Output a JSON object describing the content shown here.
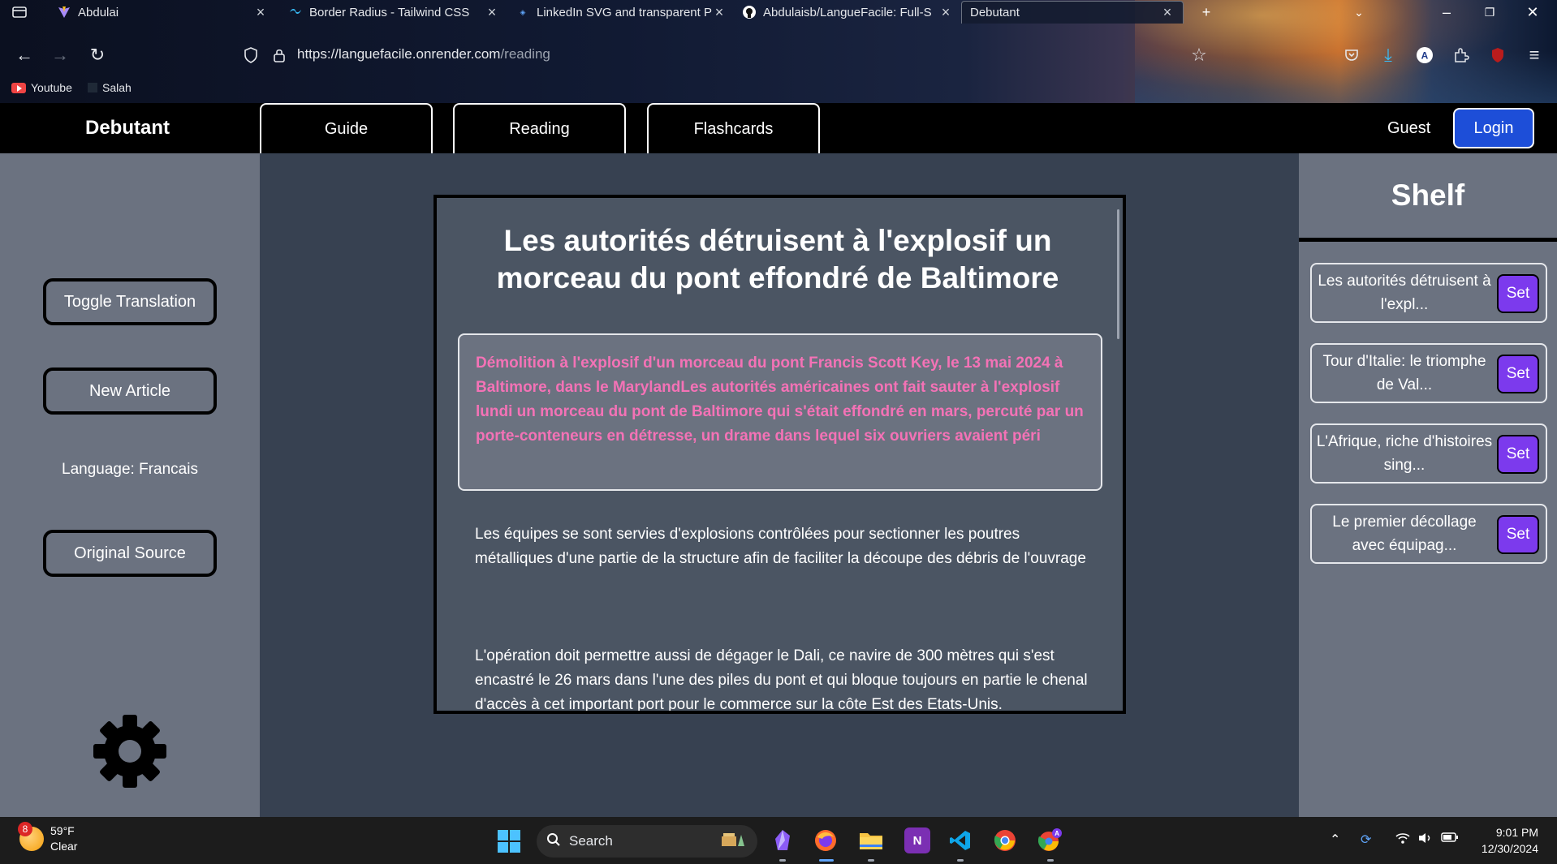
{
  "browser": {
    "tabs": [
      {
        "title": "Abdulai",
        "active": false
      },
      {
        "title": "Border Radius - Tailwind CSS",
        "active": false
      },
      {
        "title": "LinkedIn SVG and transparent P",
        "active": false
      },
      {
        "title": "Abdulaisb/LangueFacile: Full-S",
        "active": false
      },
      {
        "title": "Debutant",
        "active": true
      }
    ],
    "url_host": "https://languefacile.onrender.com",
    "url_path": "/reading",
    "bookmarks": [
      "Youtube",
      "Salah"
    ]
  },
  "header": {
    "brand": "Debutant",
    "tabs": [
      "Guide",
      "Reading",
      "Flashcards"
    ],
    "guest_label": "Guest",
    "login_label": "Login"
  },
  "sidebar": {
    "toggle_translation": "Toggle Translation",
    "new_article": "New Article",
    "language": "Language: Francais",
    "original_source": "Original Source"
  },
  "article": {
    "title": "Les autorités détruisent à l'explosif un morceau du pont effondré de Baltimore",
    "lead": "Démolition à l'explosif d'un morceau du pont Francis Scott Key, le 13 mai 2024 à Baltimore, dans le MarylandLes autorités américaines ont fait sauter à l'explosif lundi un morceau du pont de Baltimore qui s'était effondré en mars, percuté par un porte-conteneurs en détresse, un drame dans lequel six ouvriers avaient péri",
    "paragraphs": [
      "Les équipes se sont servies d'explosions contrôlées pour sectionner les poutres métalliques d'une partie de la structure afin de faciliter la découpe des débris de l'ouvrage",
      "L'opération doit permettre aussi de dégager le Dali, ce navire de 300 mètres qui s'est encastré le 26 mars dans l'une des piles du pont et qui bloque toujours en partie le chenal d'accès à cet important port pour le commerce sur la côte Est des Etats-Unis."
    ],
    "lead_color": "#f472b6"
  },
  "shelf": {
    "title": "Shelf",
    "items": [
      {
        "label": "Les autorités détruisent à l'expl...",
        "button": "Set"
      },
      {
        "label": "Tour d'Italie: le triomphe de Val...",
        "button": "Set"
      },
      {
        "label": "L'Afrique, riche d'histoires sing...",
        "button": "Set"
      },
      {
        "label": "Le premier décollage avec équipag...",
        "button": "Set"
      }
    ],
    "button_color": "#7c3aed"
  },
  "taskbar": {
    "weather_badge": "8",
    "temperature": "59°F",
    "condition": "Clear",
    "search_placeholder": "Search",
    "time": "9:01 PM",
    "date": "12/30/2024"
  },
  "colors": {
    "header_bg": "#000000",
    "login_bg": "#1d4ed8",
    "panel_bg": "#6b7280",
    "center_bg": "#374151",
    "article_bg": "#4b5563"
  }
}
